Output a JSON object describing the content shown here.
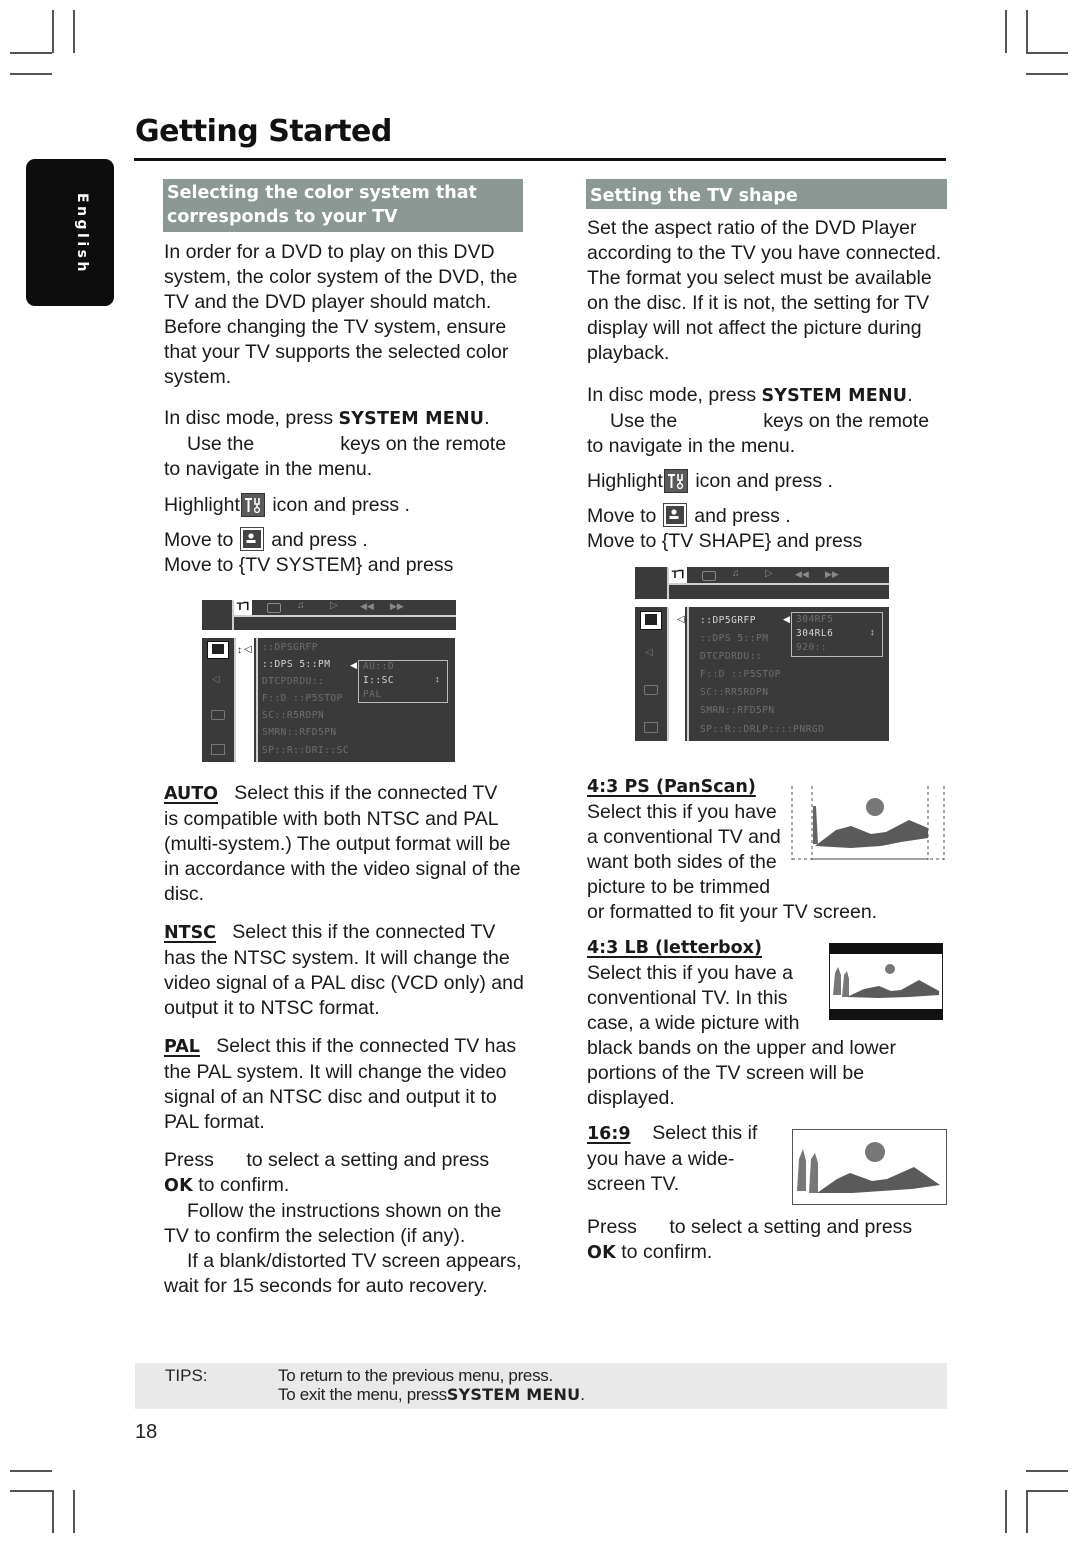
{
  "page": {
    "title": "Getting Started",
    "language_tab": "English",
    "page_number": "18"
  },
  "left_section": {
    "heading_line1": "Selecting the color system that",
    "heading_line2": "corresponds to your TV",
    "intro": [
      "In order for a DVD to play on this DVD",
      "system, the color system of the DVD, the",
      "TV and the DVD player should match.",
      "Before changing the TV system, ensure",
      "that your TV supports the selected color",
      "system."
    ],
    "step1_prefix": "In disc mode, press ",
    "step1_key": "SYSTEM MENU",
    "step1_suffix": ".",
    "step2_line1a": "Use the",
    "step2_line1b": "keys on the remote",
    "step2_line2": "to navigate in the menu.",
    "step3_prefix": "Highlight",
    "step3_suffix": "icon and press  .",
    "step4_prefix": "Move to",
    "step4_suffix": "and press  .",
    "step5": "Move to {TV SYSTEM} and press",
    "osd": {
      "menu_items": [
        "::DPSGRFP",
        "::DPS 5::PM",
        "DTCPDRDU::",
        "F::D ::P5STOP",
        "SC::R5RDPN",
        "SMRN::RFD5PN",
        "SP::R::DRI::SC"
      ],
      "options": [
        "AU::D",
        "I::SC",
        "PAL"
      ],
      "selected_option": "I::SC"
    },
    "options": [
      {
        "key": "AUTO",
        "lines": [
          "Select this if the connected TV",
          "is compatible with both NTSC and PAL",
          "(multi-system.)  The output format will be",
          "in accordance with the video signal of the",
          "disc."
        ]
      },
      {
        "key": "NTSC",
        "lines": [
          "Select this if the connected TV",
          "has the NTSC system. It will change the",
          "video signal of a PAL disc (VCD only) and",
          "output it to NTSC format."
        ]
      },
      {
        "key": "PAL",
        "lines": [
          "Select this if the connected TV has",
          "the PAL system. It will change the video",
          "signal of an NTSC disc and output it to",
          "PAL format."
        ]
      }
    ],
    "confirm_line1": "Press      to select a setting and press",
    "confirm_ok": "OK",
    "confirm_line2": " to confirm.",
    "note1_line1": "Follow the instructions shown on the",
    "note1_line2": "TV to confirm the selection (if any).",
    "note2_line1": "If a blank/distorted TV screen appears,",
    "note2_line2": "wait for 15 seconds for auto recovery."
  },
  "right_section": {
    "heading": "Setting the TV shape",
    "intro": [
      "Set the aspect ratio of the DVD Player",
      "according to the TV you have connected.",
      "The format you select must be available",
      "on the disc.  If it is not, the setting for TV",
      "display will not affect the picture during",
      "playback."
    ],
    "step1_prefix": "In disc mode, press ",
    "step1_key": "SYSTEM MENU",
    "step1_suffix": ".",
    "step2_line1a": "Use the",
    "step2_line1b": "keys on the remote",
    "step2_line2": "to navigate in the menu.",
    "step3_prefix": "Highlight",
    "step3_suffix": "icon and press  .",
    "step4_prefix": "Move to",
    "step4_suffix": "and press  .",
    "step5": "Move to {TV SHAPE} and press",
    "osd": {
      "menu_items": [
        "::DP5GRFP",
        "::DPS 5::PM",
        "DTCPDRDU::",
        "F::D ::P5STOP",
        "SC::RR5RDPN",
        "SMRN::RFD5PN",
        "SP::R::DRLP::::PNRGD"
      ],
      "options": [
        "304RF5",
        "304RL6",
        "920::"
      ],
      "selected_option": "304RL6"
    },
    "shapes": [
      {
        "key": "4:3 PS (PanScan)",
        "lines": [
          "Select this if you have",
          "a conventional TV and",
          "want both sides of the",
          "picture to be trimmed",
          "or formatted to fit your TV screen."
        ]
      },
      {
        "key": "4:3 LB (letterbox)",
        "lines": [
          "Select this if you have a",
          "conventional TV. In this",
          "case, a wide picture with",
          "black bands on the upper and lower",
          "portions of the TV screen will be",
          "displayed."
        ]
      },
      {
        "key": "16:9",
        "lines": [
          "Select this if",
          "you have a wide-",
          "screen TV."
        ]
      }
    ],
    "confirm_line1": "Press      to select a setting and press",
    "confirm_ok": "OK",
    "confirm_line2": " to confirm."
  },
  "tips": {
    "label": "TIPS:",
    "line1": "To return to the previous menu, press.",
    "line2_prefix": "To exit the menu, press",
    "line2_key": "SYSTEM MENU",
    "line2_suffix": "."
  },
  "colors": {
    "section_header_bg": "#8b9893",
    "osd_bg": "#3a3a3a",
    "tips_bg": "#e8e9e8",
    "language_tab_bg": "#0d0d0d"
  }
}
